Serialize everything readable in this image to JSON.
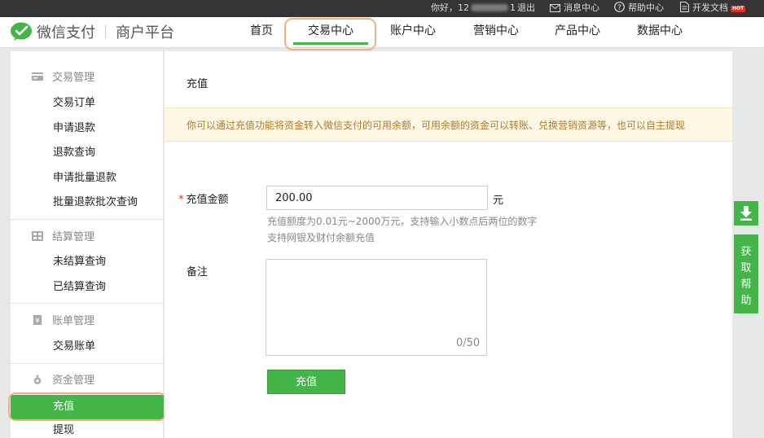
{
  "topbar": {
    "greeting_prefix": "你好，12",
    "greeting_suffix": "1",
    "logout": "退出",
    "messages": "消息中心",
    "help": "帮助中心",
    "docs": "开发文档",
    "docs_badge": "HOT"
  },
  "header": {
    "logo_text": "微信支付",
    "logo_sub": "商户平台",
    "nav": [
      {
        "label": "首页"
      },
      {
        "label": "交易中心"
      },
      {
        "label": "账户中心"
      },
      {
        "label": "营销中心"
      },
      {
        "label": "产品中心"
      },
      {
        "label": "数据中心"
      }
    ],
    "active_nav": "交易中心"
  },
  "sidebar": {
    "groups": [
      {
        "title": "交易管理",
        "icon": "card-icon",
        "items": [
          "交易订单",
          "申请退款",
          "退款查询",
          "申请批量退款",
          "批量退款批次查询"
        ]
      },
      {
        "title": "结算管理",
        "icon": "grid-icon",
        "items": [
          "未结算查询",
          "已结算查询"
        ]
      },
      {
        "title": "账单管理",
        "icon": "yen-bill-icon",
        "items": [
          "交易账单"
        ]
      },
      {
        "title": "资金管理",
        "icon": "money-bag-icon",
        "items": [
          "充值",
          "提现"
        ]
      }
    ],
    "active_item": "充值"
  },
  "main": {
    "title": "充值",
    "notice": "你可以通过充值功能将资金转入微信支付的可用余额，可用余额的资金可以转账、兑换营销资源等，也可以自主提现",
    "amount_label": "充值金额",
    "amount_value": "200.00",
    "amount_unit": "元",
    "hint_line1": "充值额度为0.01元~2000万元，支持输入小数点后两位的数字",
    "hint_line2": "支持网银及财付余额充值",
    "remark_label": "备注",
    "remark_counter": "0/50",
    "submit_label": "充值"
  },
  "float": {
    "help_chars": [
      "获",
      "取",
      "帮",
      "助"
    ]
  },
  "colors": {
    "accent": "#44b549",
    "topbar": "#353535",
    "notice_bg": "#fdf8e4",
    "notice_text": "#b07c2a",
    "highlight": "#f0b27a"
  }
}
